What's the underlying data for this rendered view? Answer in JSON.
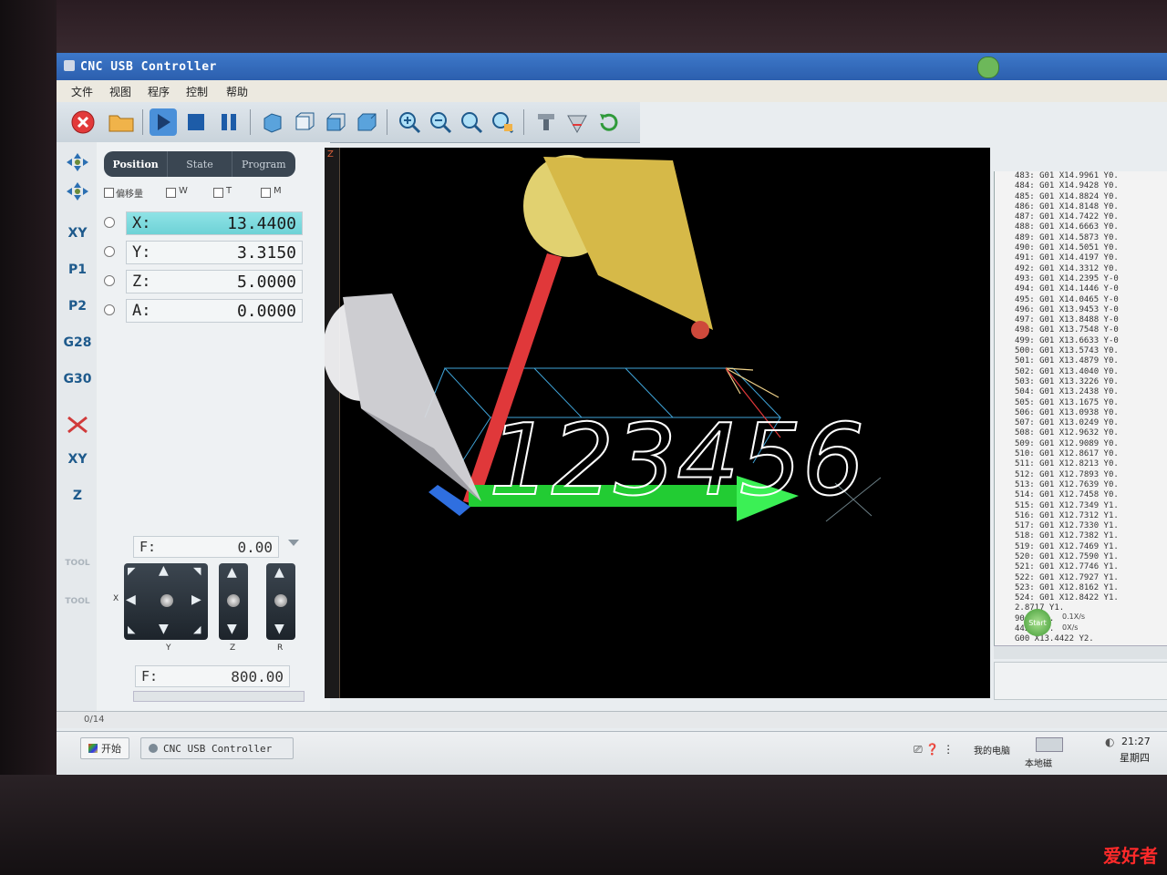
{
  "window": {
    "title": "CNC USB Controller"
  },
  "menu": [
    "文件",
    "视图",
    "程序",
    "控制",
    "帮助"
  ],
  "toolbar": {
    "icons": [
      "stop-icon",
      "open-folder-icon",
      "play-icon",
      "stop-square-icon",
      "pause-icon",
      "view-3d-icon",
      "view-front-icon",
      "view-side-icon",
      "view-top-icon",
      "zoom-in-icon",
      "zoom-out-icon",
      "zoom-fit-icon",
      "zoom-window-icon",
      "machine-icon",
      "toolpath-icon",
      "reset-icon"
    ]
  },
  "left_strip": [
    "XY",
    "P1",
    "P2",
    "G28",
    "G30",
    "XY",
    "Z",
    "TOOL",
    "TOOL"
  ],
  "tabs": [
    "Position",
    "State",
    "Program"
  ],
  "checks": [
    "偏移量",
    "W",
    "T",
    "M"
  ],
  "axes": [
    {
      "name": "X:",
      "value": "13.4400",
      "active": true
    },
    {
      "name": "Y:",
      "value": "3.3150",
      "active": false
    },
    {
      "name": "Z:",
      "value": "5.0000",
      "active": false
    },
    {
      "name": "A:",
      "value": "0.0000",
      "active": false
    }
  ],
  "feed_top": {
    "name": "F:",
    "value": "0.00"
  },
  "feed_bottom": {
    "name": "F:",
    "value": "800.00"
  },
  "jog_labels": {
    "x": "X",
    "y": "Y",
    "z": "Z",
    "r": "R"
  },
  "viewport": {
    "z_label": "Z",
    "text": "123456"
  },
  "gcode_lines": [
    "483: G01 X14.9961 Y0.",
    "484: G01 X14.9428 Y0.",
    "485: G01 X14.8824 Y0.",
    "486: G01 X14.8148 Y0.",
    "487: G01 X14.7422 Y0.",
    "488: G01 X14.6663 Y0.",
    "489: G01 X14.5873 Y0.",
    "490: G01 X14.5051 Y0.",
    "491: G01 X14.4197 Y0.",
    "492: G01 X14.3312 Y0.",
    "493: G01 X14.2395 Y-0",
    "494: G01 X14.1446 Y-0",
    "495: G01 X14.0465 Y-0",
    "496: G01 X13.9453 Y-0",
    "497: G01 X13.8488 Y-0",
    "498: G01 X13.7548 Y-0",
    "499: G01 X13.6633 Y-0",
    "500: G01 X13.5743 Y0.",
    "501: G01 X13.4879 Y0.",
    "502: G01 X13.4040 Y0.",
    "503: G01 X13.3226 Y0.",
    "504: G01 X13.2438 Y0.",
    "505: G01 X13.1675 Y0.",
    "506: G01 X13.0938 Y0.",
    "507: G01 X13.0249 Y0.",
    "508: G01 X12.9632 Y0.",
    "509: G01 X12.9089 Y0.",
    "510: G01 X12.8617 Y0.",
    "511: G01 X12.8213 Y0.",
    "512: G01 X12.7893 Y0.",
    "513: G01 X12.7639 Y0.",
    "514: G01 X12.7458 Y0.",
    "515: G01 X12.7349 Y1.",
    "516: G01 X12.7312 Y1.",
    "517: G01 X12.7330 Y1.",
    "518: G01 X12.7382 Y1.",
    "519: G01 X12.7469 Y1.",
    "520: G01 X12.7590 Y1.",
    "521: G01 X12.7746 Y1.",
    "522: G01 X12.7927 Y1.",
    "523: G01 X12.8162 Y1.",
    "524: G01 X12.8422 Y1.",
    "2.8717 Y1.",
    "9047 Y1.",
    "4422 Y3.",
    "G00 X13.4422 Y2."
  ],
  "gcode_controls": {
    "start": "Start",
    "speed1": "0.1X/s",
    "speed2": "0X/s"
  },
  "status": {
    "progress": "0/14"
  },
  "taskbar": {
    "start": "开始",
    "app": "CNC USB Controller",
    "my_computer": "我的电脑",
    "local_disk": "本地磁",
    "time": "21:27",
    "weekday": "星期四"
  },
  "watermark": "爱好者",
  "colors": {
    "x_axis": "#22cc33",
    "y_axis": "#e0383a",
    "tool": "#f5e37a",
    "path": "#3fa3d8"
  }
}
